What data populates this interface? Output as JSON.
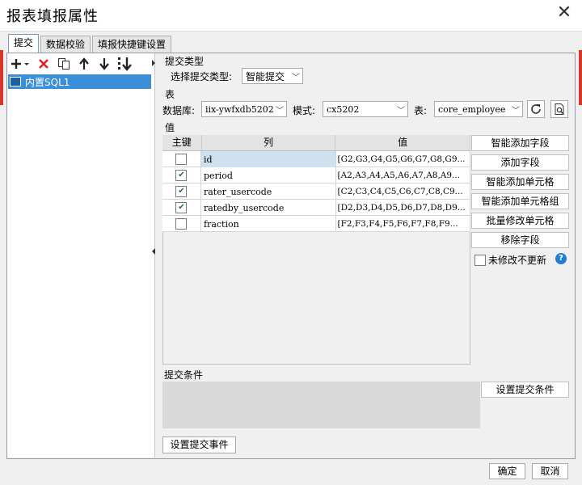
{
  "window": {
    "title": "报表填报属性"
  },
  "tabs": [
    {
      "label": "提交"
    },
    {
      "label": "数据校验"
    },
    {
      "label": "填报快捷键设置"
    }
  ],
  "sidebar": {
    "tree": [
      {
        "label": "内置SQL1"
      }
    ]
  },
  "submit_type": {
    "section_label": "提交类型",
    "select_label": "选择提交类型:",
    "selected": "智能提交"
  },
  "table_section": {
    "section_label": "表",
    "database_label": "数据库:",
    "database_value": "iix-ywfxdb5202",
    "schema_label": "模式:",
    "schema_value": "cx5202",
    "table_label": "表:",
    "table_value": "core_employee"
  },
  "value_section": {
    "section_label": "值",
    "columns": [
      "主键",
      "列",
      "值"
    ],
    "rows": [
      {
        "key": false,
        "column": "id",
        "value": "[G2,G3,G4,G5,G6,G7,G8,G9..."
      },
      {
        "key": true,
        "column": "period",
        "value": "[A2,A3,A4,A5,A6,A7,A8,A9..."
      },
      {
        "key": true,
        "column": "rater_usercode",
        "value": "[C2,C3,C4,C5,C6,C7,C8,C9..."
      },
      {
        "key": true,
        "column": "ratedby_usercode",
        "value": "[D2,D3,D4,D5,D6,D7,D8,D9..."
      },
      {
        "key": false,
        "column": "fraction",
        "value": "[F2,F3,F4,F5,F6,F7,F8,F9..."
      }
    ],
    "buttons": {
      "smart_add_field": "智能添加字段",
      "add_field": "添加字段",
      "smart_add_cell": "智能添加单元格",
      "smart_add_cell_group": "智能添加单元格组",
      "batch_modify_cell": "批量修改单元格",
      "remove_field": "移除字段"
    },
    "no_update_label": "未修改不更新",
    "help_icon": "?"
  },
  "conditions": {
    "section_label": "提交条件",
    "set_button": "设置提交条件"
  },
  "event_button": "设置提交事件",
  "footer": {
    "ok": "确定",
    "cancel": "取消"
  },
  "colors": {
    "accent": "#3b8fd8",
    "delete": "#e02020",
    "brand_red": "#d8362a"
  }
}
